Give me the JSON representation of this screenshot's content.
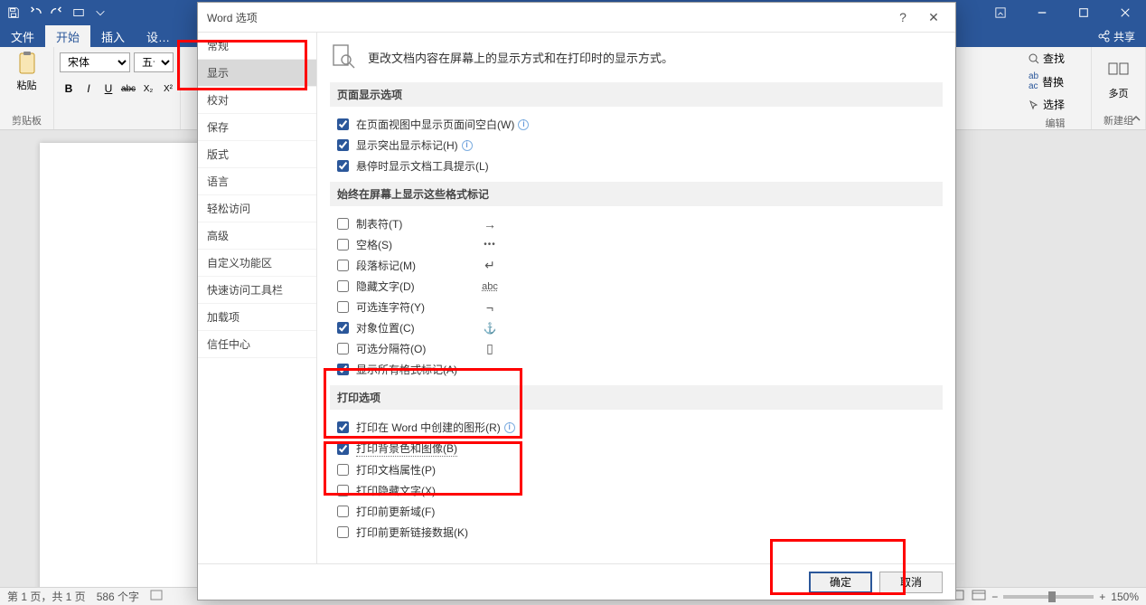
{
  "titlebar": {
    "ribbon_display": "⋯"
  },
  "tabs": {
    "file": "文件",
    "home": "开始",
    "insert": "插入",
    "design_partial": "设…"
  },
  "share": {
    "label": "共享"
  },
  "ribbon": {
    "clipboard_label": "剪贴板",
    "paste_label": "粘贴",
    "font_name": "宋体",
    "font_size": "五号",
    "bold": "B",
    "italic": "I",
    "underline": "U",
    "strike": "abc",
    "sub": "X₂",
    "sup": "X²",
    "edit": {
      "find": "查找",
      "replace": "替换",
      "select": "选择",
      "label": "编辑"
    },
    "multipage": "多页",
    "newgroup": "新建组"
  },
  "status": {
    "page": "第 1 页，共 1 页",
    "words": "586 个字",
    "zoom": "150%"
  },
  "dialog": {
    "title": "Word 选项",
    "sidebar": {
      "general": "常规",
      "display": "显示",
      "proof": "校对",
      "save": "保存",
      "format": "版式",
      "language": "语言",
      "ease": "轻松访问",
      "advanced": "高级",
      "customize_ribbon": "自定义功能区",
      "qat": "快速访问工具栏",
      "addins": "加载项",
      "trust": "信任中心"
    },
    "header_text": "更改文档内容在屏幕上的显示方式和在打印时的显示方式。",
    "sections": {
      "page_display": "页面显示选项",
      "page_opts": {
        "whitespace": "在页面视图中显示页面间空白(W)",
        "highlight": "显示突出显示标记(H)",
        "tooltips": "悬停时显示文档工具提示(L)"
      },
      "formatting_marks": "始终在屏幕上显示这些格式标记",
      "marks": {
        "tab": "制表符(T)",
        "space": "空格(S)",
        "para": "段落标记(M)",
        "hidden": "隐藏文字(D)",
        "hyphen": "可选连字符(Y)",
        "anchor": "对象位置(C)",
        "optbreak": "可选分隔符(O)",
        "all": "显示所有格式标记(A)"
      },
      "sym": {
        "tab": "→",
        "space": "•••",
        "para": "↵",
        "hidden": "abc",
        "hyphen": "¬",
        "anchor": "⚓",
        "optbreak": "▯"
      },
      "print": "打印选项",
      "print_opts": {
        "drawings": "打印在 Word 中创建的图形(R)",
        "background": "打印背景色和图像(B)",
        "props": "打印文档属性(P)",
        "hidden": "打印隐藏文字(X)",
        "fields": "打印前更新域(F)",
        "links": "打印前更新链接数据(K)"
      }
    },
    "ok": "确定",
    "cancel": "取消"
  }
}
